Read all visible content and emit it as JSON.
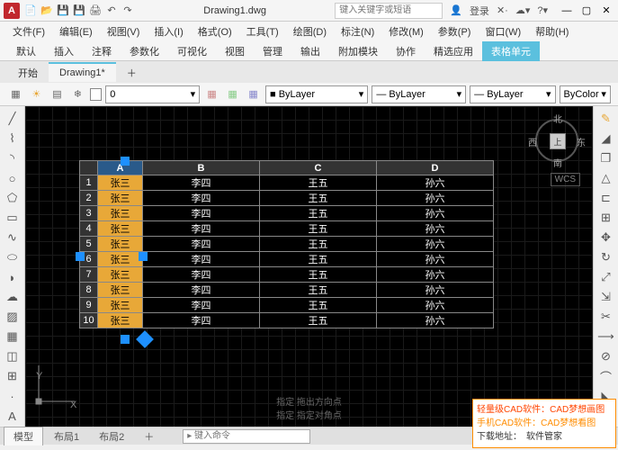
{
  "titlebar": {
    "app_letter": "A",
    "title": "Drawing1.dwg",
    "search_placeholder": "键入关键字或短语",
    "login": "登录"
  },
  "menu": [
    "文件(F)",
    "编辑(E)",
    "视图(V)",
    "插入(I)",
    "格式(O)",
    "工具(T)",
    "绘图(D)",
    "标注(N)",
    "修改(M)",
    "参数(P)",
    "窗口(W)",
    "帮助(H)"
  ],
  "ribbon_tabs": [
    "默认",
    "插入",
    "注释",
    "参数化",
    "可视化",
    "视图",
    "管理",
    "输出",
    "附加模块",
    "协作",
    "精选应用",
    "表格单元"
  ],
  "file_tabs": {
    "start": "开始",
    "current": "Drawing1*"
  },
  "layers": {
    "num": "0",
    "by1": "ByLayer",
    "by2": "ByLayer",
    "by3": "ByLayer",
    "by4": "ByColor"
  },
  "compass": {
    "n": "北",
    "s": "南",
    "e": "东",
    "w": "西",
    "top": "上",
    "wcs": "WCS"
  },
  "table": {
    "headers": [
      "",
      "A",
      "B",
      "C",
      "D"
    ],
    "rows": [
      {
        "n": "1",
        "a": "张三",
        "b": "李四",
        "c": "王五",
        "d": "孙六"
      },
      {
        "n": "2",
        "a": "张三",
        "b": "李四",
        "c": "王五",
        "d": "孙六"
      },
      {
        "n": "3",
        "a": "张三",
        "b": "李四",
        "c": "王五",
        "d": "孙六"
      },
      {
        "n": "4",
        "a": "张三",
        "b": "李四",
        "c": "王五",
        "d": "孙六"
      },
      {
        "n": "5",
        "a": "张三",
        "b": "李四",
        "c": "王五",
        "d": "孙六"
      },
      {
        "n": "6",
        "a": "张三",
        "b": "李四",
        "c": "王五",
        "d": "孙六"
      },
      {
        "n": "7",
        "a": "张三",
        "b": "李四",
        "c": "王五",
        "d": "孙六"
      },
      {
        "n": "8",
        "a": "张三",
        "b": "李四",
        "c": "王五",
        "d": "孙六"
      },
      {
        "n": "9",
        "a": "张三",
        "b": "李四",
        "c": "王五",
        "d": "孙六"
      },
      {
        "n": "10",
        "a": "张三",
        "b": "李四",
        "c": "王五",
        "d": "孙六"
      }
    ]
  },
  "ucs": {
    "x": "X",
    "y": "Y"
  },
  "cmd_hints": {
    "l1": "指定 拖出方向点",
    "l2": "指定 指定对角点"
  },
  "bottom": {
    "model": "模型",
    "layout1": "布局1",
    "layout2": "布局2",
    "cmd_ph": "▸ 键入命令"
  },
  "promo": {
    "l1": "轻量级CAD软件：CAD梦想画图",
    "l2": "手机CAD软件：CAD梦想看图",
    "l3": "下载地址：　软件管家"
  }
}
